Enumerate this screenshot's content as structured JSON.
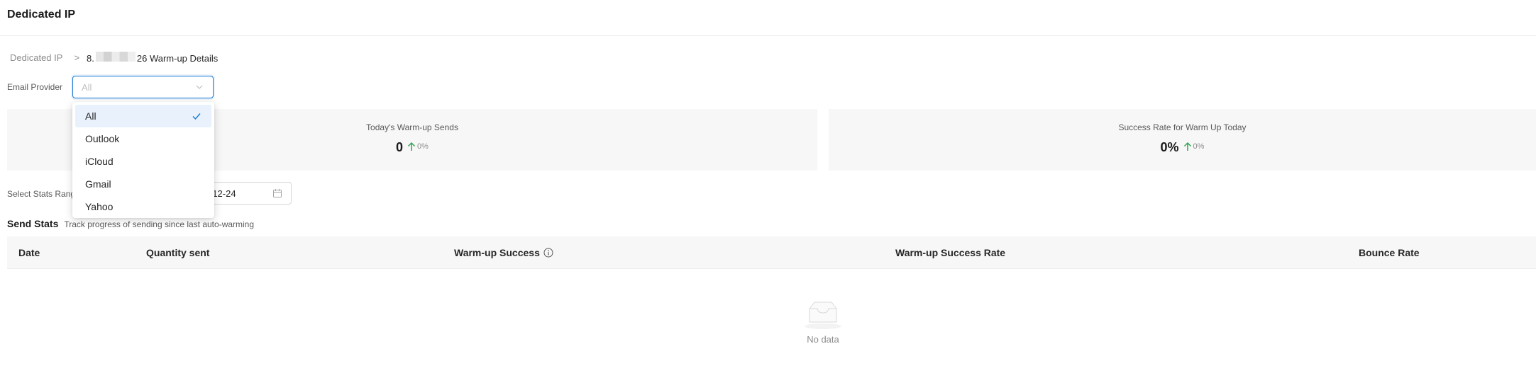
{
  "header": {
    "title": "Dedicated IP"
  },
  "breadcrumb": {
    "root": "Dedicated IP",
    "separator": ">",
    "current_prefix": "8.",
    "current_suffix": "26 Warm-up Details"
  },
  "filter": {
    "label": "Email Provider",
    "placeholder": "All",
    "options": [
      {
        "label": "All",
        "selected": true
      },
      {
        "label": "Outlook",
        "selected": false
      },
      {
        "label": "iCloud",
        "selected": false
      },
      {
        "label": "Gmail",
        "selected": false
      },
      {
        "label": "Yahoo",
        "selected": false
      }
    ]
  },
  "stats": {
    "sends": {
      "title": "Today's Warm-up Sends",
      "value": "0",
      "change": "0%"
    },
    "success_rate": {
      "title": "Success Rate for Warm Up Today",
      "value": "0%",
      "change": "0%"
    },
    "trend_color": "#2ea44f"
  },
  "range": {
    "label": "Select Stats Range",
    "end_date_visible": "-12-24"
  },
  "send_stats": {
    "heading": "Send Stats",
    "subtitle": "Track progress of sending since last auto-warming"
  },
  "table": {
    "columns": [
      "Date",
      "Quantity sent",
      "Warm-up Success",
      "Warm-up Success Rate",
      "Bounce Rate"
    ],
    "empty_text": "No data"
  },
  "colors": {
    "accent": "#1677d2",
    "selected_bg": "#e8f1fc",
    "card_bg": "#f7f7f7"
  }
}
